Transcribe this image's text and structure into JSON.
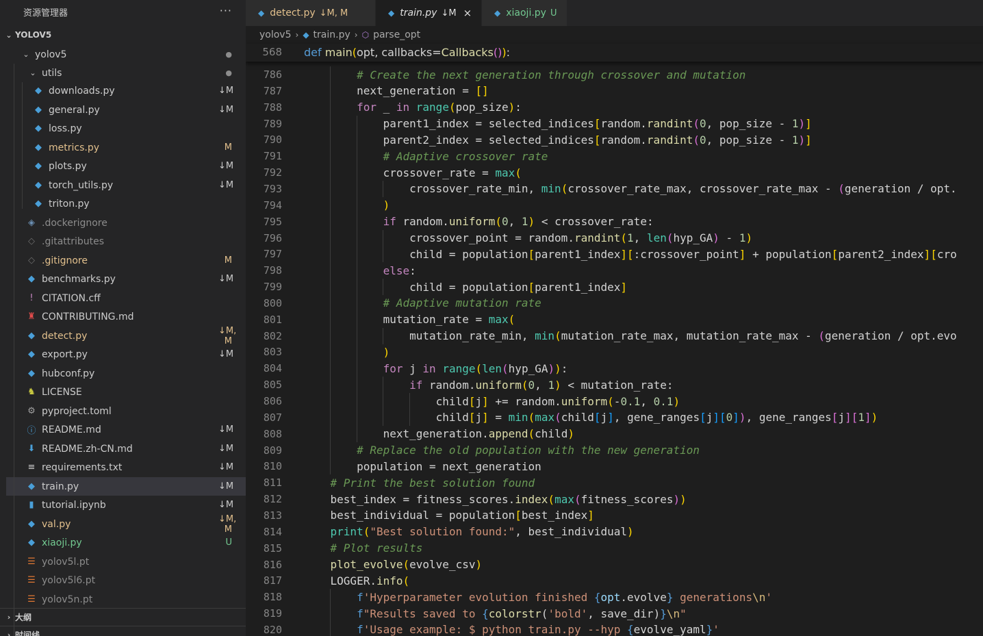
{
  "explorer": {
    "title": "资源管理器",
    "more": "···",
    "workspace": "YOLOV5",
    "outline_label": "大纲",
    "timeline_label": "时间线",
    "items": [
      {
        "name": "yolov5",
        "kind": "folder",
        "status": "●"
      },
      {
        "name": "utils",
        "kind": "folder",
        "status": "●"
      },
      {
        "name": "downloads.py",
        "kind": "py",
        "status": "↓M"
      },
      {
        "name": "general.py",
        "kind": "py",
        "status": "↓M"
      },
      {
        "name": "loss.py",
        "kind": "py",
        "status": ""
      },
      {
        "name": "metrics.py",
        "kind": "py",
        "status": "M"
      },
      {
        "name": "plots.py",
        "kind": "py",
        "status": "↓M"
      },
      {
        "name": "torch_utils.py",
        "kind": "py",
        "status": "↓M"
      },
      {
        "name": "triton.py",
        "kind": "py",
        "status": ""
      },
      {
        "name": ".dockerignore",
        "kind": "docker",
        "status": ""
      },
      {
        "name": ".gitattributes",
        "kind": "git",
        "status": ""
      },
      {
        "name": ".gitignore",
        "kind": "git",
        "status": "M"
      },
      {
        "name": "benchmarks.py",
        "kind": "py",
        "status": "↓M"
      },
      {
        "name": "CITATION.cff",
        "kind": "cff",
        "status": ""
      },
      {
        "name": "CONTRIBUTING.md",
        "kind": "contrib",
        "status": ""
      },
      {
        "name": "detect.py",
        "kind": "py",
        "status": "↓M, M"
      },
      {
        "name": "export.py",
        "kind": "py",
        "status": "↓M"
      },
      {
        "name": "hubconf.py",
        "kind": "py",
        "status": ""
      },
      {
        "name": "LICENSE",
        "kind": "license",
        "status": ""
      },
      {
        "name": "pyproject.toml",
        "kind": "toml",
        "status": ""
      },
      {
        "name": "README.md",
        "kind": "info",
        "status": "↓M"
      },
      {
        "name": "README.zh-CN.md",
        "kind": "down",
        "status": "↓M"
      },
      {
        "name": "requirements.txt",
        "kind": "txt",
        "status": "↓M"
      },
      {
        "name": "train.py",
        "kind": "py",
        "status": "↓M"
      },
      {
        "name": "tutorial.ipynb",
        "kind": "nb",
        "status": "↓M"
      },
      {
        "name": "val.py",
        "kind": "py",
        "status": "↓M, M"
      },
      {
        "name": "xiaoji.py",
        "kind": "py",
        "status": "U"
      },
      {
        "name": "yolov5l.pt",
        "kind": "rss",
        "status": ""
      },
      {
        "name": "yolov5l6.pt",
        "kind": "rss",
        "status": ""
      },
      {
        "name": "yolov5n.pt",
        "kind": "rss",
        "status": ""
      }
    ]
  },
  "tabs": [
    {
      "label": "detect.py",
      "status": "↓M, M",
      "active": false
    },
    {
      "label": "train.py",
      "status": "↓M",
      "active": true,
      "close": "×"
    },
    {
      "label": "xiaoji.py",
      "status": "U",
      "active": false
    }
  ],
  "breadcrumb": [
    "yolov5",
    "train.py",
    "parse_opt"
  ],
  "sticky": {
    "num": "568",
    "code": "def main(opt, callbacks=Callbacks()):"
  },
  "lines": [
    {
      "n": "786",
      "code": "        # Create the next generation through crossover and mutation"
    },
    {
      "n": "787",
      "code": "        next_generation = []"
    },
    {
      "n": "788",
      "code": "        for _ in range(pop_size):"
    },
    {
      "n": "789",
      "code": "            parent1_index = selected_indices[random.randint(0, pop_size - 1)]"
    },
    {
      "n": "790",
      "code": "            parent2_index = selected_indices[random.randint(0, pop_size - 1)]"
    },
    {
      "n": "791",
      "code": "            # Adaptive crossover rate"
    },
    {
      "n": "792",
      "code": "            crossover_rate = max("
    },
    {
      "n": "793",
      "code": "                crossover_rate_min, min(crossover_rate_max, crossover_rate_max - (generation / opt."
    },
    {
      "n": "794",
      "code": "            )"
    },
    {
      "n": "795",
      "code": "            if random.uniform(0, 1) < crossover_rate:"
    },
    {
      "n": "796",
      "code": "                crossover_point = random.randint(1, len(hyp_GA) - 1)"
    },
    {
      "n": "797",
      "code": "                child = population[parent1_index][:crossover_point] + population[parent2_index][cro"
    },
    {
      "n": "798",
      "code": "            else:"
    },
    {
      "n": "799",
      "code": "                child = population[parent1_index]"
    },
    {
      "n": "800",
      "code": "            # Adaptive mutation rate"
    },
    {
      "n": "801",
      "code": "            mutation_rate = max("
    },
    {
      "n": "802",
      "code": "                mutation_rate_min, min(mutation_rate_max, mutation_rate_max - (generation / opt.evo"
    },
    {
      "n": "803",
      "code": "            )"
    },
    {
      "n": "804",
      "code": "            for j in range(len(hyp_GA)):"
    },
    {
      "n": "805",
      "code": "                if random.uniform(0, 1) < mutation_rate:"
    },
    {
      "n": "806",
      "code": "                    child[j] += random.uniform(-0.1, 0.1)"
    },
    {
      "n": "807",
      "code": "                    child[j] = min(max(child[j], gene_ranges[j][0]), gene_ranges[j][1])"
    },
    {
      "n": "808",
      "code": "            next_generation.append(child)"
    },
    {
      "n": "809",
      "code": "        # Replace the old population with the new generation"
    },
    {
      "n": "810",
      "code": "        population = next_generation"
    },
    {
      "n": "811",
      "code": "    # Print the best solution found"
    },
    {
      "n": "812",
      "code": "    best_index = fitness_scores.index(max(fitness_scores))"
    },
    {
      "n": "813",
      "code": "    best_individual = population[best_index]"
    },
    {
      "n": "814",
      "code": "    print(\"Best solution found:\", best_individual)"
    },
    {
      "n": "815",
      "code": "    # Plot results"
    },
    {
      "n": "816",
      "code": "    plot_evolve(evolve_csv)"
    },
    {
      "n": "817",
      "code": "    LOGGER.info("
    },
    {
      "n": "818",
      "code": "        f'Hyperparameter evolution finished {opt.evolve} generations\\n'"
    },
    {
      "n": "819",
      "code": "        f\"Results saved to {colorstr('bold', save_dir)}\\n\""
    },
    {
      "n": "820",
      "code": "        f'Usage example: $ python train.py --hyp {evolve_yaml}'"
    }
  ],
  "colors": {
    "modified": "#e2c08d",
    "untracked": "#73c991",
    "ignored": "#8c8c8c",
    "py_icon": "#4a9fd8",
    "accent": "#569cd6"
  }
}
